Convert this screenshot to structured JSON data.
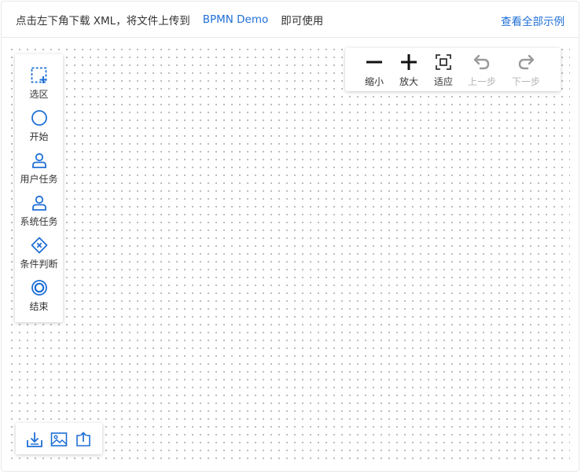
{
  "header": {
    "instruction_before": "点击左下角下载 XML，将文件上传到",
    "demo_link": "BPMN Demo",
    "instruction_after": "即可使用",
    "view_all_link": "查看全部示例"
  },
  "palette": {
    "items": [
      {
        "label": "选区",
        "icon": "selection-icon"
      },
      {
        "label": "开始",
        "icon": "start-event-icon"
      },
      {
        "label": "用户任务",
        "icon": "user-task-icon"
      },
      {
        "label": "系统任务",
        "icon": "system-task-icon"
      },
      {
        "label": "条件判断",
        "icon": "exclusive-gateway-icon"
      },
      {
        "label": "结束",
        "icon": "end-event-icon"
      }
    ]
  },
  "controls": {
    "zoom_out": "缩小",
    "zoom_in": "放大",
    "fit": "适应",
    "undo": "上一步",
    "redo": "下一步"
  },
  "bottom_actions": {
    "icons": [
      "download-xml-icon",
      "export-image-icon",
      "upload-icon"
    ]
  },
  "colors": {
    "accent": "#1f6fd6",
    "text": "#333333",
    "disabled": "#b5b5b5",
    "grid_dot": "#b9b9b9"
  }
}
